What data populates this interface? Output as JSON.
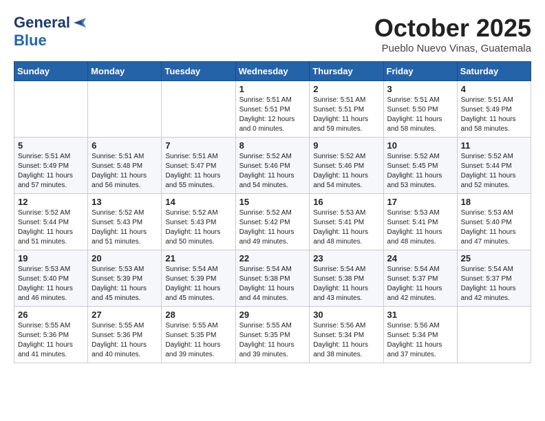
{
  "header": {
    "logo_general": "General",
    "logo_blue": "Blue",
    "month_title": "October 2025",
    "location": "Pueblo Nuevo Vinas, Guatemala"
  },
  "days_of_week": [
    "Sunday",
    "Monday",
    "Tuesday",
    "Wednesday",
    "Thursday",
    "Friday",
    "Saturday"
  ],
  "weeks": [
    [
      {
        "day": "",
        "info": ""
      },
      {
        "day": "",
        "info": ""
      },
      {
        "day": "",
        "info": ""
      },
      {
        "day": "1",
        "info": "Sunrise: 5:51 AM\nSunset: 5:51 PM\nDaylight: 12 hours\nand 0 minutes."
      },
      {
        "day": "2",
        "info": "Sunrise: 5:51 AM\nSunset: 5:51 PM\nDaylight: 11 hours\nand 59 minutes."
      },
      {
        "day": "3",
        "info": "Sunrise: 5:51 AM\nSunset: 5:50 PM\nDaylight: 11 hours\nand 58 minutes."
      },
      {
        "day": "4",
        "info": "Sunrise: 5:51 AM\nSunset: 5:49 PM\nDaylight: 11 hours\nand 58 minutes."
      }
    ],
    [
      {
        "day": "5",
        "info": "Sunrise: 5:51 AM\nSunset: 5:49 PM\nDaylight: 11 hours\nand 57 minutes."
      },
      {
        "day": "6",
        "info": "Sunrise: 5:51 AM\nSunset: 5:48 PM\nDaylight: 11 hours\nand 56 minutes."
      },
      {
        "day": "7",
        "info": "Sunrise: 5:51 AM\nSunset: 5:47 PM\nDaylight: 11 hours\nand 55 minutes."
      },
      {
        "day": "8",
        "info": "Sunrise: 5:52 AM\nSunset: 5:46 PM\nDaylight: 11 hours\nand 54 minutes."
      },
      {
        "day": "9",
        "info": "Sunrise: 5:52 AM\nSunset: 5:46 PM\nDaylight: 11 hours\nand 54 minutes."
      },
      {
        "day": "10",
        "info": "Sunrise: 5:52 AM\nSunset: 5:45 PM\nDaylight: 11 hours\nand 53 minutes."
      },
      {
        "day": "11",
        "info": "Sunrise: 5:52 AM\nSunset: 5:44 PM\nDaylight: 11 hours\nand 52 minutes."
      }
    ],
    [
      {
        "day": "12",
        "info": "Sunrise: 5:52 AM\nSunset: 5:44 PM\nDaylight: 11 hours\nand 51 minutes."
      },
      {
        "day": "13",
        "info": "Sunrise: 5:52 AM\nSunset: 5:43 PM\nDaylight: 11 hours\nand 51 minutes."
      },
      {
        "day": "14",
        "info": "Sunrise: 5:52 AM\nSunset: 5:43 PM\nDaylight: 11 hours\nand 50 minutes."
      },
      {
        "day": "15",
        "info": "Sunrise: 5:52 AM\nSunset: 5:42 PM\nDaylight: 11 hours\nand 49 minutes."
      },
      {
        "day": "16",
        "info": "Sunrise: 5:53 AM\nSunset: 5:41 PM\nDaylight: 11 hours\nand 48 minutes."
      },
      {
        "day": "17",
        "info": "Sunrise: 5:53 AM\nSunset: 5:41 PM\nDaylight: 11 hours\nand 48 minutes."
      },
      {
        "day": "18",
        "info": "Sunrise: 5:53 AM\nSunset: 5:40 PM\nDaylight: 11 hours\nand 47 minutes."
      }
    ],
    [
      {
        "day": "19",
        "info": "Sunrise: 5:53 AM\nSunset: 5:40 PM\nDaylight: 11 hours\nand 46 minutes."
      },
      {
        "day": "20",
        "info": "Sunrise: 5:53 AM\nSunset: 5:39 PM\nDaylight: 11 hours\nand 45 minutes."
      },
      {
        "day": "21",
        "info": "Sunrise: 5:54 AM\nSunset: 5:39 PM\nDaylight: 11 hours\nand 45 minutes."
      },
      {
        "day": "22",
        "info": "Sunrise: 5:54 AM\nSunset: 5:38 PM\nDaylight: 11 hours\nand 44 minutes."
      },
      {
        "day": "23",
        "info": "Sunrise: 5:54 AM\nSunset: 5:38 PM\nDaylight: 11 hours\nand 43 minutes."
      },
      {
        "day": "24",
        "info": "Sunrise: 5:54 AM\nSunset: 5:37 PM\nDaylight: 11 hours\nand 42 minutes."
      },
      {
        "day": "25",
        "info": "Sunrise: 5:54 AM\nSunset: 5:37 PM\nDaylight: 11 hours\nand 42 minutes."
      }
    ],
    [
      {
        "day": "26",
        "info": "Sunrise: 5:55 AM\nSunset: 5:36 PM\nDaylight: 11 hours\nand 41 minutes."
      },
      {
        "day": "27",
        "info": "Sunrise: 5:55 AM\nSunset: 5:36 PM\nDaylight: 11 hours\nand 40 minutes."
      },
      {
        "day": "28",
        "info": "Sunrise: 5:55 AM\nSunset: 5:35 PM\nDaylight: 11 hours\nand 39 minutes."
      },
      {
        "day": "29",
        "info": "Sunrise: 5:55 AM\nSunset: 5:35 PM\nDaylight: 11 hours\nand 39 minutes."
      },
      {
        "day": "30",
        "info": "Sunrise: 5:56 AM\nSunset: 5:34 PM\nDaylight: 11 hours\nand 38 minutes."
      },
      {
        "day": "31",
        "info": "Sunrise: 5:56 AM\nSunset: 5:34 PM\nDaylight: 11 hours\nand 37 minutes."
      },
      {
        "day": "",
        "info": ""
      }
    ]
  ]
}
